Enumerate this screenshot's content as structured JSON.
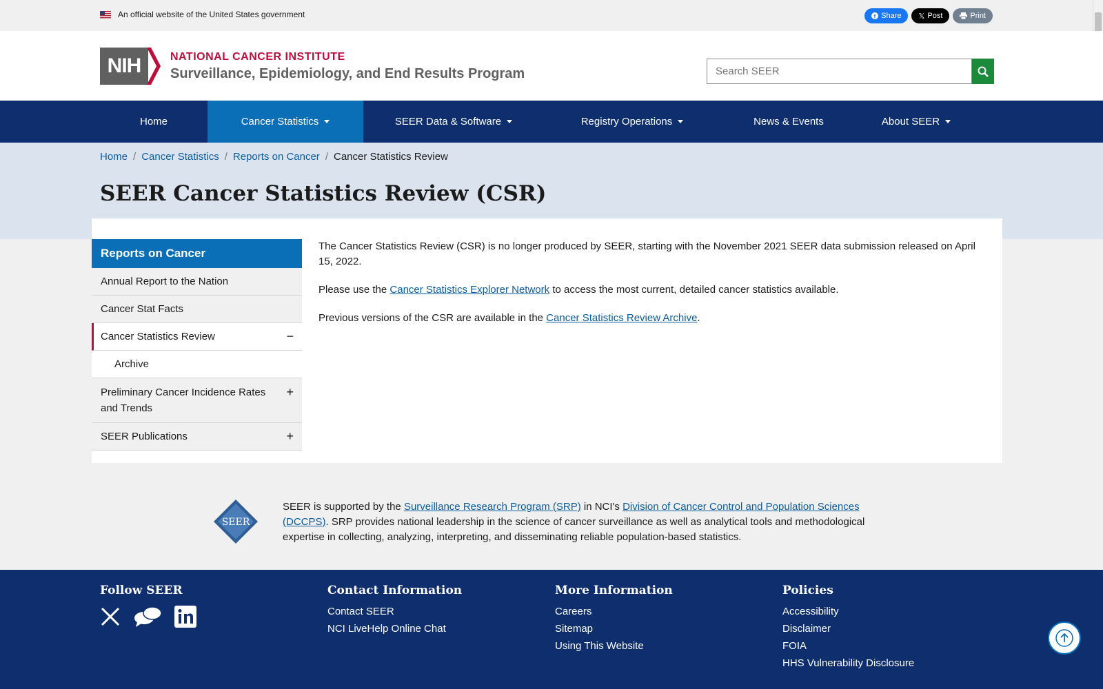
{
  "gov_banner": {
    "text": "An official website of the United States government"
  },
  "share": {
    "facebook": "Share",
    "x": "Post",
    "print": "Print"
  },
  "header": {
    "org": "NATIONAL CANCER INSTITUTE",
    "program": "Surveillance, Epidemiology, and End Results Program",
    "logo_text": "NIH"
  },
  "search": {
    "placeholder": "Search SEER"
  },
  "nav": {
    "items": [
      {
        "label": "Home"
      },
      {
        "label": "Cancer Statistics"
      },
      {
        "label": "SEER Data & Software"
      },
      {
        "label": "Registry Operations"
      },
      {
        "label": "News & Events"
      },
      {
        "label": "About SEER"
      }
    ]
  },
  "breadcrumb": [
    "Home",
    "Cancer Statistics",
    "Reports on Cancer",
    "Cancer Statistics Review"
  ],
  "page_title": "SEER Cancer Statistics Review (CSR)",
  "sidebar": {
    "heading": "Reports on Cancer",
    "items": [
      {
        "label": "Annual Report to the Nation"
      },
      {
        "label": "Cancer Stat Facts"
      },
      {
        "label": "Cancer Statistics Review",
        "toggle": "−"
      },
      {
        "label": "Archive"
      },
      {
        "label": "Preliminary Cancer Incidence Rates and Trends",
        "toggle": "+"
      },
      {
        "label": "SEER Publications",
        "toggle": "+"
      }
    ]
  },
  "content": {
    "p1": "The Cancer Statistics Review (CSR) is no longer produced by SEER, starting with the November 2021 SEER data submission released on April 15, 2022.",
    "p2_pre": "Please use the ",
    "p2_link": "Cancer Statistics Explorer Network",
    "p2_post": " to access the most current, detailed cancer statistics available.",
    "p3_pre": "Previous versions of the CSR are available in the ",
    "p3_link": "Cancer Statistics Review Archive",
    "p3_post": "."
  },
  "support": {
    "logo_text": "SEER",
    "t1": "SEER is supported by the ",
    "link1": "Surveillance Research Program (SRP)",
    "t2": " in NCI's ",
    "link2": "Division of Cancer Control and Population Sciences (DCCPS)",
    "t3": ". SRP provides national leadership in the science of cancer surveillance as well as analytical tools and methodological expertise in collecting, analyzing, interpreting, and disseminating reliable population-based statistics."
  },
  "footer": {
    "follow": {
      "heading": "Follow SEER"
    },
    "contact": {
      "heading": "Contact Information",
      "links": [
        "Contact SEER",
        "NCI LiveHelp Online Chat"
      ]
    },
    "more": {
      "heading": "More Information",
      "links": [
        "Careers",
        "Sitemap",
        "Using This Website"
      ]
    },
    "policies": {
      "heading": "Policies",
      "links": [
        "Accessibility",
        "Disclaimer",
        "FOIA",
        "HHS Vulnerability Disclosure"
      ]
    }
  },
  "colors": {
    "navy": "#0e2e6e",
    "blue": "#0b6fb8",
    "red": "#bb0e3d",
    "green": "#1b8a3a"
  }
}
